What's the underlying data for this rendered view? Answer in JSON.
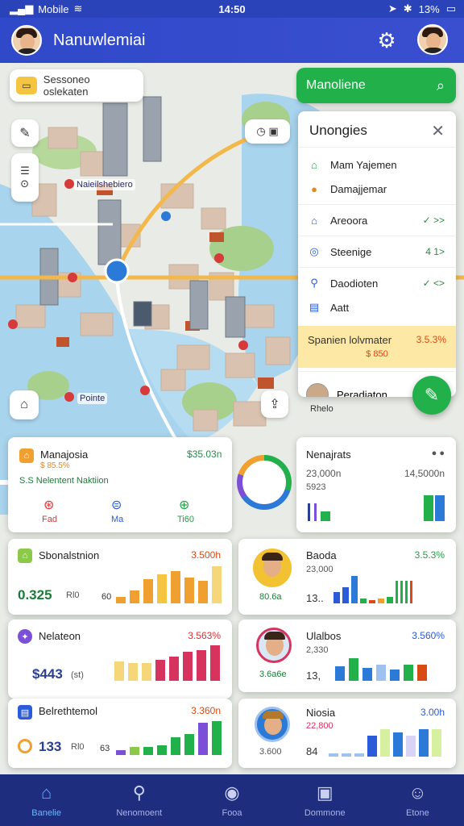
{
  "status": {
    "carrier": "Mobile",
    "time": "14:50",
    "battery": "13%"
  },
  "appbar": {
    "title": "Nanuwlemiai"
  },
  "map": {
    "search_placeholder": "Sessoneo oslekaten",
    "labels": [
      "Naieilshebiero",
      "Pointe",
      "Rhelo"
    ]
  },
  "panel": {
    "header": "Manoliene",
    "title": "Unongies",
    "items": [
      {
        "label": "Mam Yajemen",
        "icon": "home-icon"
      },
      {
        "label": "Damajjemar",
        "icon": "pin-icon"
      },
      {
        "label": "Areoora",
        "icon": "arrow-icon",
        "right": "✓ >>"
      },
      {
        "label": "Steenige",
        "icon": "circle-icon",
        "right": "4 1>"
      },
      {
        "label": "Daodioten",
        "icon": "location-icon",
        "right": "✓ <>"
      },
      {
        "label": "Aatt",
        "icon": "bus-icon",
        "right": ""
      }
    ],
    "promo_label": "Spanien lolvmater",
    "promo_value": "3.5.3%",
    "promo_sub": "$ 850",
    "user_label": "Peradiaton"
  },
  "cards": {
    "top_left": {
      "title": "Manajosia",
      "value": "$35.03n",
      "sub_value": "$ 85.5%",
      "line": "S.S  Nelentent Naktiion",
      "buttons": [
        "Fad",
        "Ma",
        "Ti60"
      ]
    },
    "top_right": {
      "title": "Nenajrats",
      "left_val": "23,000n",
      "left_sub": "5923",
      "right_val": "14,5000n"
    },
    "r1_left": {
      "title": "Sbonalstnion",
      "value": "3.500h",
      "big": "0.325",
      "sm": "Rl0",
      "axis": "60"
    },
    "r1_right": {
      "title": "Baoda",
      "value": "3.5.3%",
      "sub": "23,000",
      "avatar_label": "80.6a",
      "axis": "13.."
    },
    "r2_left": {
      "title": "Nelateon",
      "value": "3.563%",
      "big": "$443",
      "sm": "(st)"
    },
    "r2_right": {
      "title": "Ulalbos",
      "value": "3.560%",
      "sub": "2,330",
      "avatar_label": "3.6a6e",
      "axis": "13,"
    },
    "r3_left": {
      "title": "Belrethtemol",
      "value": "3.360n",
      "big": "133",
      "sm": "Rl0",
      "axis": "63"
    },
    "r3_right": {
      "title": "Niosia",
      "value": "3.00h",
      "sub": "22,800",
      "avatar_label": "3.600",
      "axis": "84"
    }
  },
  "nav": [
    {
      "label": "Banelie",
      "icon": "home-icon"
    },
    {
      "label": "Nenomoent",
      "icon": "search-icon"
    },
    {
      "label": "Fooa",
      "icon": "compass-icon"
    },
    {
      "label": "Dommone",
      "icon": "briefcase-icon"
    },
    {
      "label": "Etone",
      "icon": "user-icon"
    }
  ],
  "colors": {
    "primary": "#2f49c9",
    "accent_green": "#22b04b",
    "nav": "#1f2d7e"
  }
}
